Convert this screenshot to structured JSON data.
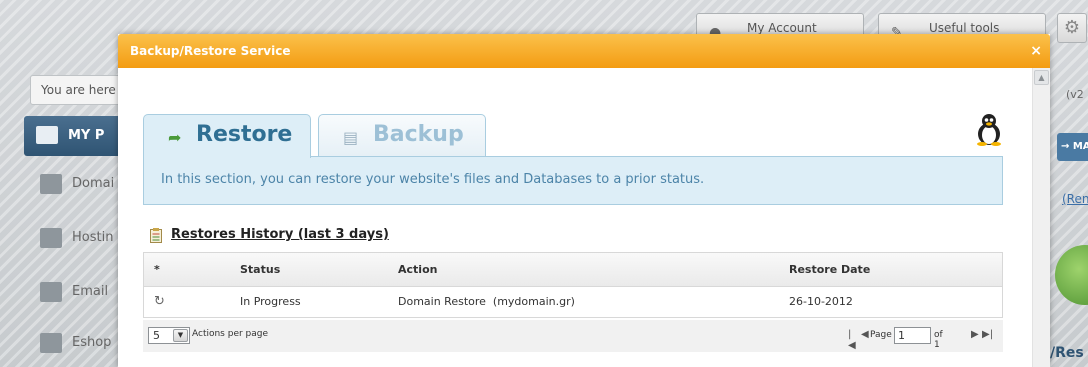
{
  "background": {
    "top_buttons": {
      "my_account": "My Account",
      "useful_tools": "Useful tools"
    },
    "breadcrumb_prefix": "You are here",
    "panel_title": "MY P",
    "sidebar_items": [
      "Domai",
      "Hostin",
      "Email",
      "Eshop"
    ],
    "right_version": "(v2",
    "right_button": "→ MA",
    "right_link": "(Ren",
    "right_caption": "/Res"
  },
  "modal": {
    "title": "Backup/Restore Service",
    "close_symbol": "×",
    "scroll_up_symbol": "▲",
    "tabs": [
      {
        "label": "Restore",
        "icon": "arrow-forward-icon",
        "active": true
      },
      {
        "label": "Backup",
        "icon": "document-icon",
        "active": false
      }
    ],
    "os_icon": "linux-tux-icon",
    "info_text": "In this section, you can restore your website's files and Databases to a prior status.",
    "history": {
      "title": "Restores History (last 3 days)",
      "columns": [
        "*",
        "Status",
        "Action",
        "Restore Date"
      ],
      "rows": [
        {
          "icon": "refresh-icon",
          "status": "In Progress",
          "action": "Domain Restore  (mydomain.gr)",
          "date": "26-10-2012"
        }
      ]
    },
    "pagination": {
      "per_page_value": "5",
      "per_page_label": "Actions per page",
      "page_label": "Page",
      "current_page": "1",
      "of_label": "of 1"
    }
  },
  "colors": {
    "header_orange": "#f39c12",
    "tab_blue_bg": "#ddeef7",
    "tab_border": "#a9cde0",
    "info_text": "#4c84a8"
  }
}
